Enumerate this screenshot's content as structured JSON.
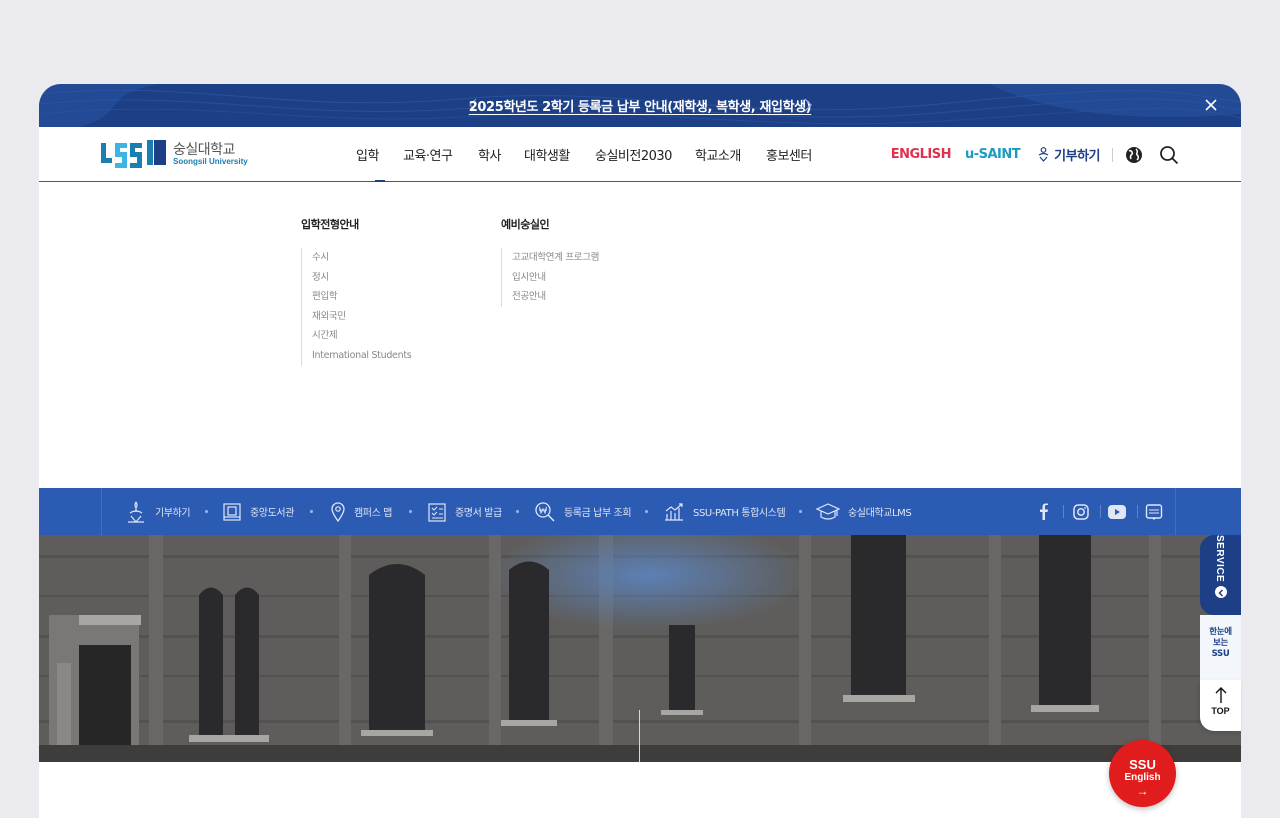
{
  "notice": {
    "text": "2025학년도 2학기 등록금 납부 안내(재학생, 복학생, 재입학생)"
  },
  "header": {
    "logo_ko": "숭실대학교",
    "logo_en": "Soongsil University",
    "nav": [
      "입학",
      "교육·연구",
      "학사",
      "대학생활",
      "숭실비전2030",
      "학교소개",
      "홍보센터"
    ],
    "active_nav": "입학",
    "utils": {
      "english": "ENGLISH",
      "usaint": "u-SAINT",
      "donate": "기부하기"
    }
  },
  "mega_menu": {
    "columns": [
      {
        "title": "입학전형안내",
        "items": [
          "수시",
          "정시",
          "편입학",
          "재외국민",
          "시간제",
          "International Students"
        ]
      },
      {
        "title": "예비숭실인",
        "items": [
          "고교대학연계 프로그램",
          "입시안내",
          "전공안내"
        ]
      }
    ]
  },
  "quick_links": [
    {
      "label": "기부하기",
      "icon": "donate-icon"
    },
    {
      "label": "중앙도서관",
      "icon": "library-icon"
    },
    {
      "label": "캠퍼스 맵",
      "icon": "map-pin-icon"
    },
    {
      "label": "증명서 발급",
      "icon": "certificate-icon"
    },
    {
      "label": "등록금 납부 조회",
      "icon": "tuition-search-icon"
    },
    {
      "label": "SSU-PATH 통합시스템",
      "icon": "chart-icon"
    },
    {
      "label": "숭실대학교LMS",
      "icon": "graduation-cap-icon"
    }
  ],
  "floating": {
    "service": "SERVICE",
    "ssu_glance": [
      "한눈에",
      "보는",
      "SSU"
    ],
    "top": "TOP"
  },
  "ssu_english": {
    "line1": "SSU",
    "line2": "English",
    "arrow": "→"
  },
  "colors": {
    "navy": "#1c3f86",
    "quickbar": "#2c5bb4",
    "english_red": "#e0304e",
    "usaint_teal": "#1a9bc4",
    "badge_red": "#e01c1c"
  }
}
